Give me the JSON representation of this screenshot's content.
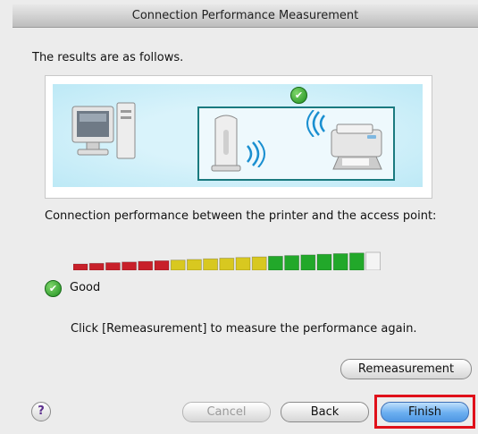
{
  "dialog": {
    "title": "Connection Performance Measurement",
    "intro": "The results are as follows.",
    "performance_label": "Connection performance between the printer and the access point:",
    "signal_meter": {
      "filled_segments": 18,
      "total_segments": 19
    },
    "result_status": "Good",
    "hint": "Click [Remeasurement] to measure the performance again."
  },
  "buttons": {
    "remeasure": "Remeasurement",
    "cancel": "Cancel",
    "back": "Back",
    "finish": "Finish",
    "help": "?"
  },
  "icons": {
    "computer": "computer-icon",
    "access_point": "access-point-icon",
    "printer": "printer-icon",
    "wifi": "wifi-waves-icon",
    "check": "checkmark-icon"
  },
  "colors": {
    "meter_red": "#c8202a",
    "meter_yellow": "#d8c820",
    "meter_green": "#22a82a",
    "meter_empty": "#f4f4f4",
    "highlight": "#e0101a",
    "default_button": "#4f97e3"
  }
}
